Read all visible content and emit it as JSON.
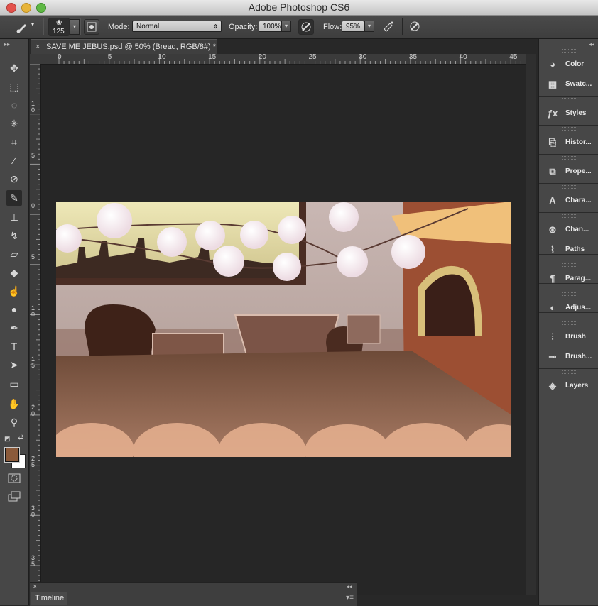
{
  "app": {
    "window_title": "Adobe Photoshop CS6"
  },
  "options_bar": {
    "brush_size": "125",
    "mode_label": "Mode:",
    "mode_value": "Normal",
    "opacity_label": "Opacity:",
    "opacity_value": "100%",
    "flow_label": "Flow:",
    "flow_value": "95%"
  },
  "document": {
    "tab_title": "SAVE ME JEBUS.psd @ 50% (Bread, RGB/8#) *",
    "close_glyph": "×"
  },
  "rulers": {
    "horizontal": [
      "0",
      "5",
      "10",
      "15",
      "20",
      "25",
      "30",
      "35",
      "40",
      "45"
    ],
    "vertical": [
      "1\n0",
      "5",
      "0",
      "5",
      "1\n0",
      "1\n5",
      "2\n0",
      "2\n5",
      "3\n0",
      "3\n5"
    ]
  },
  "tools": [
    {
      "name": "move-tool",
      "glyph": "✥"
    },
    {
      "name": "marquee-tool",
      "glyph": "⬚"
    },
    {
      "name": "lasso-tool",
      "glyph": "◌"
    },
    {
      "name": "magic-wand-tool",
      "glyph": "✳"
    },
    {
      "name": "crop-tool",
      "glyph": "⌗"
    },
    {
      "name": "eyedropper-tool",
      "glyph": "⁄"
    },
    {
      "name": "spot-healing-tool",
      "glyph": "⊘"
    },
    {
      "name": "brush-tool",
      "glyph": "✎"
    },
    {
      "name": "clone-stamp-tool",
      "glyph": "⊥"
    },
    {
      "name": "history-brush-tool",
      "glyph": "↯"
    },
    {
      "name": "eraser-tool",
      "glyph": "▱"
    },
    {
      "name": "paint-bucket-tool",
      "glyph": "◆"
    },
    {
      "name": "smudge-tool",
      "glyph": "☝"
    },
    {
      "name": "dodge-tool",
      "glyph": "●"
    },
    {
      "name": "pen-tool",
      "glyph": "✒"
    },
    {
      "name": "type-tool",
      "glyph": "T"
    },
    {
      "name": "path-selection-tool",
      "glyph": "➤"
    },
    {
      "name": "rectangle-tool",
      "glyph": "▭"
    },
    {
      "name": "hand-tool",
      "glyph": "✋"
    },
    {
      "name": "zoom-tool",
      "glyph": "⚲"
    }
  ],
  "colors": {
    "foreground": "#8b5a3a",
    "background": "#ffffff"
  },
  "panels": [
    {
      "label": "Color",
      "icon": "color-icon",
      "glyph": "◕"
    },
    {
      "label": "Swatc...",
      "icon": "swatches-icon",
      "glyph": "▦"
    },
    {
      "label": "Styles",
      "icon": "styles-icon",
      "glyph": "ƒx"
    },
    {
      "label": "Histor...",
      "icon": "history-icon",
      "glyph": "⎘"
    },
    {
      "label": "Prope...",
      "icon": "properties-icon",
      "glyph": "⧉"
    },
    {
      "label": "Chara...",
      "icon": "character-icon",
      "glyph": "A"
    },
    {
      "label": "Chan...",
      "icon": "channels-icon",
      "glyph": "⊛"
    },
    {
      "label": "Paths",
      "icon": "paths-icon",
      "glyph": "⌇"
    },
    {
      "label": "Parag...",
      "icon": "paragraph-icon",
      "glyph": "¶"
    },
    {
      "label": "Adjus...",
      "icon": "adjustments-icon",
      "glyph": "◐"
    },
    {
      "label": "Brush",
      "icon": "brush-icon",
      "glyph": "⫶"
    },
    {
      "label": "Brush...",
      "icon": "brush-presets-icon",
      "glyph": "⊸"
    },
    {
      "label": "Layers",
      "icon": "layers-icon",
      "glyph": "◈"
    }
  ],
  "timeline": {
    "tab_label": "Timeline",
    "close_glyph": "×",
    "collapse_glyph": "◂◂"
  }
}
